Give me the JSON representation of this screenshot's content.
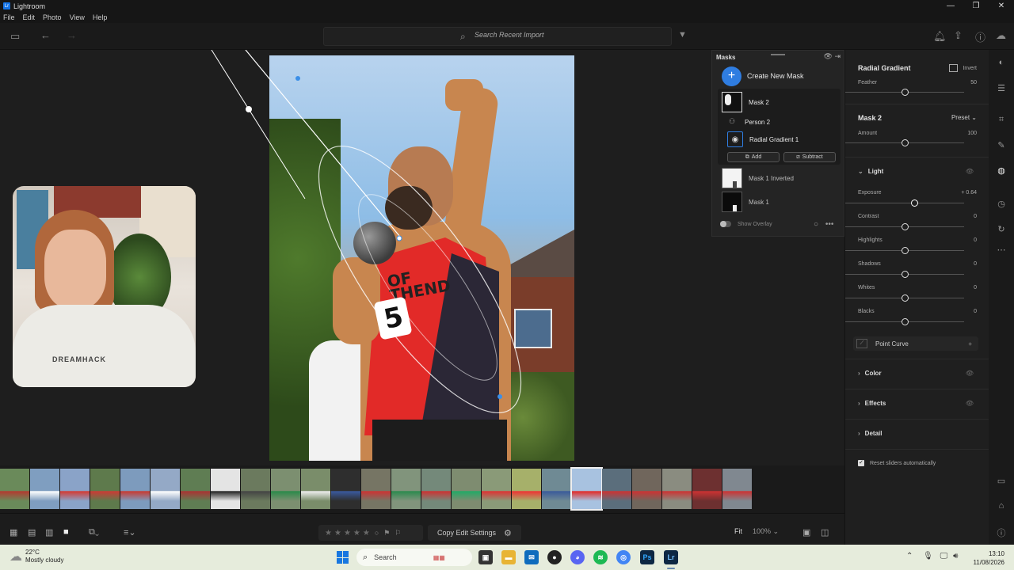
{
  "window": {
    "title": "Lightroom",
    "logo_text": "Lr",
    "controls": [
      "—",
      "❐",
      "✕"
    ]
  },
  "menu": [
    "File",
    "Edit",
    "Photo",
    "View",
    "Help"
  ],
  "toolbar": {
    "search_placeholder": "Search Recent Import"
  },
  "webcam": {
    "shirt_text": "DREAMHACK"
  },
  "masks": {
    "title": "Masks",
    "create_label": "Create New Mask",
    "items": [
      {
        "label": "Mask 2"
      },
      {
        "label": "Person 2"
      },
      {
        "label": "Radial Gradient 1"
      },
      {
        "label": "Mask 1 Inverted"
      },
      {
        "label": "Mask 1"
      }
    ],
    "add_label": "Add",
    "subtract_label": "Subtract",
    "show_overlay_label": "Show Overlay",
    "show_overlay": false
  },
  "photo": {
    "bib_number": "5",
    "vest_text": "OF\nTHEND"
  },
  "right_panel": {
    "tool_title": "Radial Gradient",
    "invert_label": "Invert",
    "feather_label": "Feather",
    "feather_value": "50",
    "feather": 50,
    "mask_title": "Mask 2",
    "preset_label": "Preset",
    "amount_label": "Amount",
    "amount_value": "100",
    "amount": 100,
    "light_label": "Light",
    "sliders": [
      {
        "label": "Exposure",
        "value": "+ 0.64",
        "position": 0.58
      },
      {
        "label": "Contrast",
        "value": "0",
        "position": 0.5
      },
      {
        "label": "Highlights",
        "value": "0",
        "position": 0.5
      },
      {
        "label": "Shadows",
        "value": "0",
        "position": 0.5
      },
      {
        "label": "Whites",
        "value": "0",
        "position": 0.5
      },
      {
        "label": "Blacks",
        "value": "0",
        "position": 0.5
      }
    ],
    "point_curve_label": "Point Curve",
    "sections": [
      "Color",
      "Effects",
      "Detail"
    ],
    "reset_label": "Reset sliders automatically",
    "reset_checked": true
  },
  "bottom": {
    "copy_edit_label": "Copy Edit Settings",
    "fit_label": "Fit",
    "zoom_label": "100%"
  },
  "taskbar": {
    "temperature": "22°C",
    "weather": "Mostly cloudy",
    "search_label": "Search",
    "time": "13:10",
    "date": "11/08/2026"
  },
  "colors": {
    "accent": "#2f7de1",
    "bg": "#1e1e1e"
  }
}
